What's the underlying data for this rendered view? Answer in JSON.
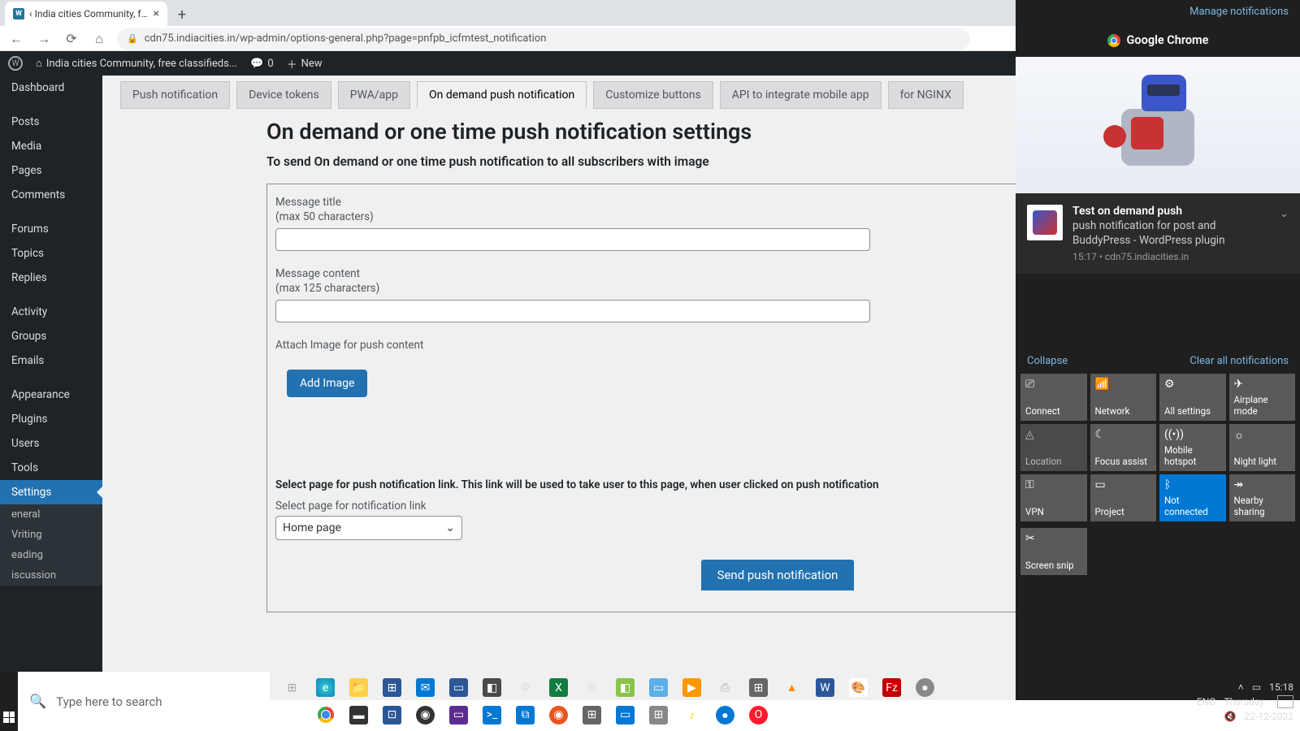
{
  "browser": {
    "tab_title": "‹ India cities Community, free cla",
    "url": "cdn75.indiacities.in/wp-admin/options-general.php?page=pnfpb_icfmtest_notification"
  },
  "adminbar": {
    "site": "India cities Community, free classifieds...",
    "comments": "0",
    "new": "New"
  },
  "sidebar": {
    "items": [
      "Dashboard",
      "Posts",
      "Media",
      "Pages",
      "Comments",
      "Forums",
      "Topics",
      "Replies",
      "Activity",
      "Groups",
      "Emails",
      "Appearance",
      "Plugins",
      "Users",
      "Tools",
      "Settings"
    ],
    "subs": [
      "eneral",
      "Vriting",
      "eading",
      "iscussion"
    ]
  },
  "tabs": [
    "Push notification",
    "Device tokens",
    "PWA/app",
    "On demand push notification",
    "Customize buttons",
    "API to integrate mobile app",
    "for NGINX"
  ],
  "page": {
    "title": "On demand or one time push notification settings",
    "subtitle": "To send On demand or one time push notification to all subscribers with image",
    "msg_title_label": "Message title",
    "msg_title_hint": "(max 50 characters)",
    "msg_content_label": "Message content",
    "msg_content_hint": "(max 125 characters)",
    "attach_label": "Attach Image for push content",
    "add_image_btn": "Add Image",
    "select_page_desc": "Select page for push notification link. This link will be used to take user to this page, when user clicked on push notification",
    "select_page_label": "Select page for notification link",
    "select_value": "Home page",
    "send_btn": "Send push notification"
  },
  "winpanel": {
    "manage": "Manage notifications",
    "app": "Google Chrome",
    "notif_title": "Test on demand push",
    "notif_text": "push notification for post and BuddyPress - WordPress plugin",
    "notif_meta": "15:17 • cdn75.indiacities.in",
    "collapse": "Collapse",
    "clear": "Clear all notifications",
    "tiles": [
      "Connect",
      "Network",
      "All settings",
      "Airplane mode",
      "Location",
      "Focus assist",
      "Mobile hotspot",
      "Night light",
      "VPN",
      "Project",
      "Not connected",
      "Nearby sharing",
      "Screen snip"
    ]
  },
  "taskbar": {
    "search_placeholder": "Type here to search",
    "time": "15:18",
    "day": "Thursday",
    "date": "22-12-2022",
    "lang": "ENG"
  }
}
